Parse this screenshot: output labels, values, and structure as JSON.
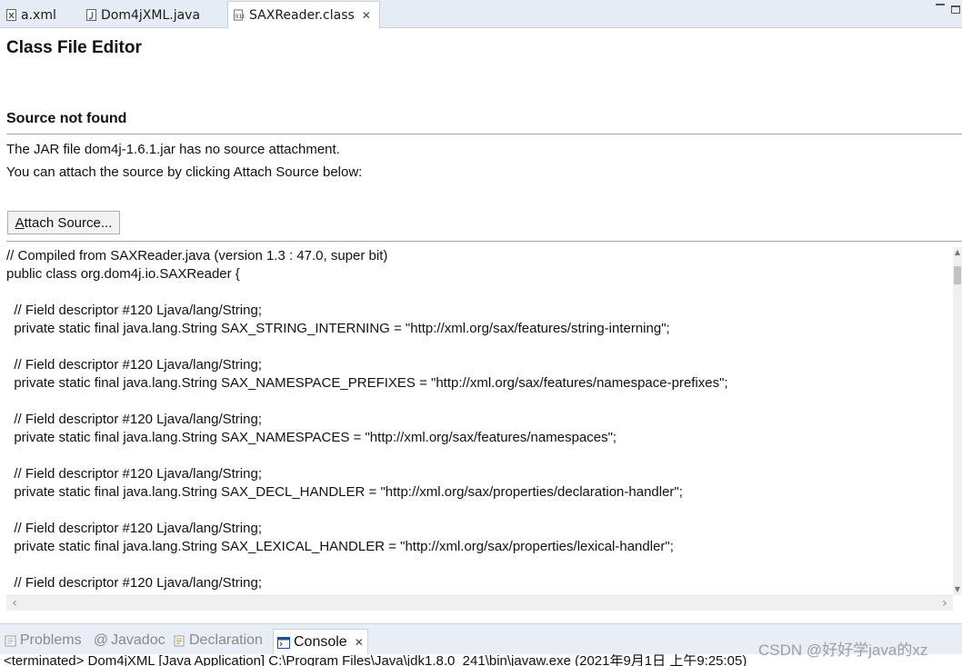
{
  "editor_tabs": [
    {
      "label": "a.xml",
      "icon": "xml-file-icon"
    },
    {
      "label": "Dom4jXML.java",
      "icon": "java-file-icon"
    },
    {
      "label": "SAXReader.class",
      "icon": "class-file-icon",
      "active": true,
      "close": "✕"
    }
  ],
  "editor": {
    "heading": "Class File Editor",
    "section_title": "Source not found",
    "message_line1": "The JAR file dom4j-1.6.1.jar has no source attachment.",
    "message_line2": "You can attach the source by clicking Attach Source below:",
    "attach_button_mnemonic": "A",
    "attach_button_rest": "ttach Source..."
  },
  "code_lines": [
    "// Compiled from SAXReader.java (version 1.3 : 47.0, super bit)",
    "public class org.dom4j.io.SAXReader {",
    "",
    "  // Field descriptor #120 Ljava/lang/String;",
    "  private static final java.lang.String SAX_STRING_INTERNING = \"http://xml.org/sax/features/string-interning\";",
    "",
    "  // Field descriptor #120 Ljava/lang/String;",
    "  private static final java.lang.String SAX_NAMESPACE_PREFIXES = \"http://xml.org/sax/features/namespace-prefixes\";",
    "",
    "  // Field descriptor #120 Ljava/lang/String;",
    "  private static final java.lang.String SAX_NAMESPACES = \"http://xml.org/sax/features/namespaces\";",
    "",
    "  // Field descriptor #120 Ljava/lang/String;",
    "  private static final java.lang.String SAX_DECL_HANDLER = \"http://xml.org/sax/properties/declaration-handler\";",
    "",
    "  // Field descriptor #120 Ljava/lang/String;",
    "  private static final java.lang.String SAX_LEXICAL_HANDLER = \"http://xml.org/sax/properties/lexical-handler\";",
    "",
    "  // Field descriptor #120 Ljava/lang/String;"
  ],
  "panel_tabs": [
    {
      "label": "Problems",
      "icon": "problems-icon"
    },
    {
      "label": "Javadoc",
      "icon": "javadoc-icon",
      "glyph": "@"
    },
    {
      "label": "Declaration",
      "icon": "declaration-icon"
    },
    {
      "label": "Console",
      "icon": "console-icon",
      "active": true,
      "close": "✕"
    }
  ],
  "console_status": "<terminated> Dom4jXML [Java Application] C:\\Program Files\\Java\\jdk1.8.0_241\\bin\\javaw.exe (2021年9月1日 上午9:25:05)",
  "watermark": "CSDN @好好学java的xz",
  "colors": {
    "tab_bar": "#e6ecf5",
    "rule": "#9aa7b8",
    "java_icon": "#2f5fa8",
    "console_icon": "#1d4f91"
  }
}
